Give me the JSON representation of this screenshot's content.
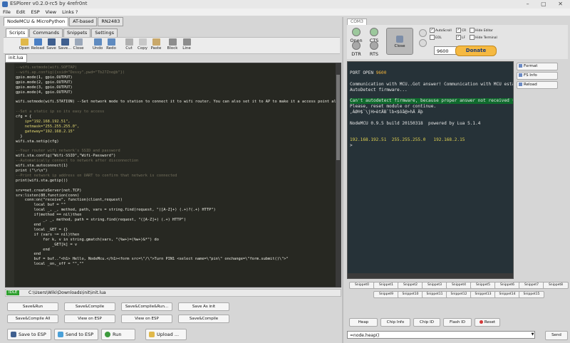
{
  "window": {
    "title": "ESPlorer v0.2.0-rc5 by 4refr0nt",
    "controls": "– ▢ ✕"
  },
  "menu": [
    "File",
    "Edit",
    "ESP",
    "View",
    "Links ?"
  ],
  "left_tabs": [
    "NodeMCU & MicroPython",
    "AT-based",
    "RN2483"
  ],
  "sub_tabs": [
    "Scripts",
    "Commands",
    "Snippets",
    "Settings"
  ],
  "toolbar": [
    "Open",
    "Reload",
    "Save",
    "Save...",
    "Close",
    "Undo",
    "Redo",
    "Cut",
    "Copy",
    "Paste",
    "Block",
    "Line"
  ],
  "file_tab": "init.lua",
  "editor": {
    "lines": [
      {
        "t": "--wifi.setmode(wifi.SOFTAP)",
        "c": "#75715e"
      },
      {
        "t": "--wifi.ap.config({ssid=\"Dessy\",pwd=\"Tb27Zne@b\"})",
        "c": "#75715e"
      },
      {
        "t": "gpio.mode(1, gpio.OUTPUT)",
        "c": "#f0f0e8"
      },
      {
        "t": "gpio.mode(2, gpio.OUTPUT)",
        "c": "#f0f0e8"
      },
      {
        "t": "gpio.mode(3, gpio.OUTPUT)",
        "c": "#f0f0e8"
      },
      {
        "t": "gpio.mode(4, gpio.OUTPUT)",
        "c": "#f0f0e8"
      },
      {
        "t": "",
        "c": "#f0f0e8"
      },
      {
        "t": "wifi.setmode(wifi.STATION) --Set network mode to station to connect it to wifi router. You can also set it to AP to make it a access point allowing connection from other wifi devices.",
        "c": "#f0f0e8"
      },
      {
        "t": "",
        "c": "#f0f0e8"
      },
      {
        "t": "--Set a static ip so its easy to access",
        "c": "#75715e"
      },
      {
        "t": "cfg = {",
        "c": "#f0f0e8"
      },
      {
        "t": "    ip=\"192.168.192.51\",",
        "c": "#e6db74"
      },
      {
        "t": "    netmask=\"255.255.255.0\",",
        "c": "#e6db74"
      },
      {
        "t": "    gateway=\"192.168.2.15\"",
        "c": "#e6db74"
      },
      {
        "t": "  }",
        "c": "#f0f0e8"
      },
      {
        "t": "wifi.sta.setip(cfg)",
        "c": "#f0f0e8"
      },
      {
        "t": "",
        "c": "#f0f0e8"
      },
      {
        "t": "--Your router wifi network's SSID and password",
        "c": "#75715e"
      },
      {
        "t": "wifi.sta.config(\"Wifi-SSID\",\"Wifi-Password\")",
        "c": "#f0f0e8"
      },
      {
        "t": "--Automatically connect to network after disconnection",
        "c": "#75715e"
      },
      {
        "t": "wifi.sta.autoconnect(1)",
        "c": "#f0f0e8"
      },
      {
        "t": "print (\"\\r\\n\")",
        "c": "#f0f0e8"
      },
      {
        "t": "--Print network ip address on UART to confirm that network is connected",
        "c": "#75715e"
      },
      {
        "t": "print(wifi.sta.getip())",
        "c": "#f0f0e8"
      },
      {
        "t": "",
        "c": "#f0f0e8"
      },
      {
        "t": "srv=net.createServer(net.TCP)",
        "c": "#f0f0e8"
      },
      {
        "t": "srv:listen(80,function(conn)",
        "c": "#f0f0e8"
      },
      {
        "t": "    conn:on(\"receive\", function(client,request)",
        "c": "#f0f0e8"
      },
      {
        "t": "        local buf = \"\"",
        "c": "#f0f0e8"
      },
      {
        "t": "        local _, _, method, path, vars = string.find(request, \"([A-Z]+) (.+)?(.+) HTTP\")",
        "c": "#f0f0e8"
      },
      {
        "t": "        if(method == nil)then",
        "c": "#f0f0e8"
      },
      {
        "t": "            _, _, method, path = string.find(request, \"([A-Z]+) (.+) HTTP\")",
        "c": "#f0f0e8"
      },
      {
        "t": "        end",
        "c": "#f0f0e8"
      },
      {
        "t": "        local _GET = {}",
        "c": "#f0f0e8"
      },
      {
        "t": "        if (vars ~= nil)then",
        "c": "#f0f0e8"
      },
      {
        "t": "            for k, v in string.gmatch(vars, \"(%w+)=(%w+)&*\") do",
        "c": "#f0f0e8"
      },
      {
        "t": "                _GET[k] = v",
        "c": "#f0f0e8"
      },
      {
        "t": "            end",
        "c": "#f0f0e8"
      },
      {
        "t": "        end",
        "c": "#f0f0e8"
      },
      {
        "t": "        buf = buf..\"<h1> Hello, NodeMcu.</h1><form src=\\\"/\\\">Turn PIN1 <select name=\\\"pin\\\" onchange=\\\"form.submit()\\\">\"",
        "c": "#f0f0e8"
      },
      {
        "t": "        local _on,_off = \"\",\"\"",
        "c": "#f0f0e8"
      }
    ]
  },
  "status": {
    "state": "IDLE",
    "path": "C:\\Users\\Wiki\\Downloads\\init\\init.lua"
  },
  "action_buttons": [
    [
      "Save&Run",
      "Save&Compile",
      "Save&Compile&Run...",
      "Save As init"
    ],
    [
      "Save&Compile All",
      "View on ESP",
      "View on ESP",
      "Save&Compile"
    ]
  ],
  "big_buttons": [
    "Save to ESP",
    "Send to ESP",
    "Run",
    "Upload ..."
  ],
  "port": {
    "tab": "COM3",
    "pins": [
      "Open",
      "CTS",
      "DTR",
      "RTS"
    ],
    "close_label": "Close",
    "options": [
      {
        "label": "AutoScroll",
        "checked": true
      },
      {
        "label": "CR",
        "checked": true
      },
      {
        "label": "Hide Editor",
        "checked": false
      },
      {
        "label": "EOL",
        "checked": false
      },
      {
        "label": "LF",
        "checked": true
      },
      {
        "label": "Hide Terminal",
        "checked": false
      }
    ],
    "baud": "9600",
    "donate": "Donate"
  },
  "terminal": {
    "lines": [
      {
        "t": "PORT OPEN 9600",
        "hl": false
      },
      {
        "t": "",
        "hl": false
      },
      {
        "t": "Communication with MCU..Got answer! Communication with MCU established.",
        "hl": false
      },
      {
        "t": "AutoDetect firmware...",
        "hl": false
      },
      {
        "t": "",
        "hl": false
      },
      {
        "t": "Can't autodetect firmware, because proper answer not received (may be unknown firmware).",
        "hl": true
      },
      {
        "t": "Please, reset module or continue.",
        "hl": false
      },
      {
        "t": ",ÁØ®$`\\jH>èt­Ä­B`lb<$ôã@>hÄ Äþ",
        "hl": false
      },
      {
        "t": "",
        "hl": false
      },
      {
        "t": "NodeMCU 0.9.5 build 20150318  powered by Lua 5.1.4",
        "hl": false
      },
      {
        "t": "",
        "hl": false
      },
      {
        "t": "",
        "hl": false
      },
      {
        "t": "192.168.192.51  255.255.255.0   192.168.2.15",
        "hl": false
      },
      {
        "t": ">",
        "hl": false
      }
    ]
  },
  "side_buttons": [
    "Format",
    "FS Info",
    "Reload"
  ],
  "snippets": [
    [
      "Snippet0",
      "Snippet1",
      "Snippet2",
      "Snippet3",
      "Snippet4",
      "Snippet5",
      "Snippet6",
      "Snippet7",
      "Snippet8"
    ],
    [
      "Snippet9",
      "Snippet10",
      "Snippet11",
      "Snippet12",
      "Snippet13",
      "Snippet14",
      "Snippet15"
    ]
  ],
  "cmd_buttons": [
    "Heap",
    "Chip Info",
    "Chip ID",
    "Flash ID",
    "Reset"
  ],
  "command": {
    "value": "=node.heap()",
    "send": "Send"
  },
  "colors": {
    "terminal_bg": "#263238",
    "editor_bg": "#272822",
    "ip_text": "#e0d050",
    "baud_text": "#f3b43a",
    "idle": "#2e9f2e",
    "donate": "#f5b941"
  }
}
